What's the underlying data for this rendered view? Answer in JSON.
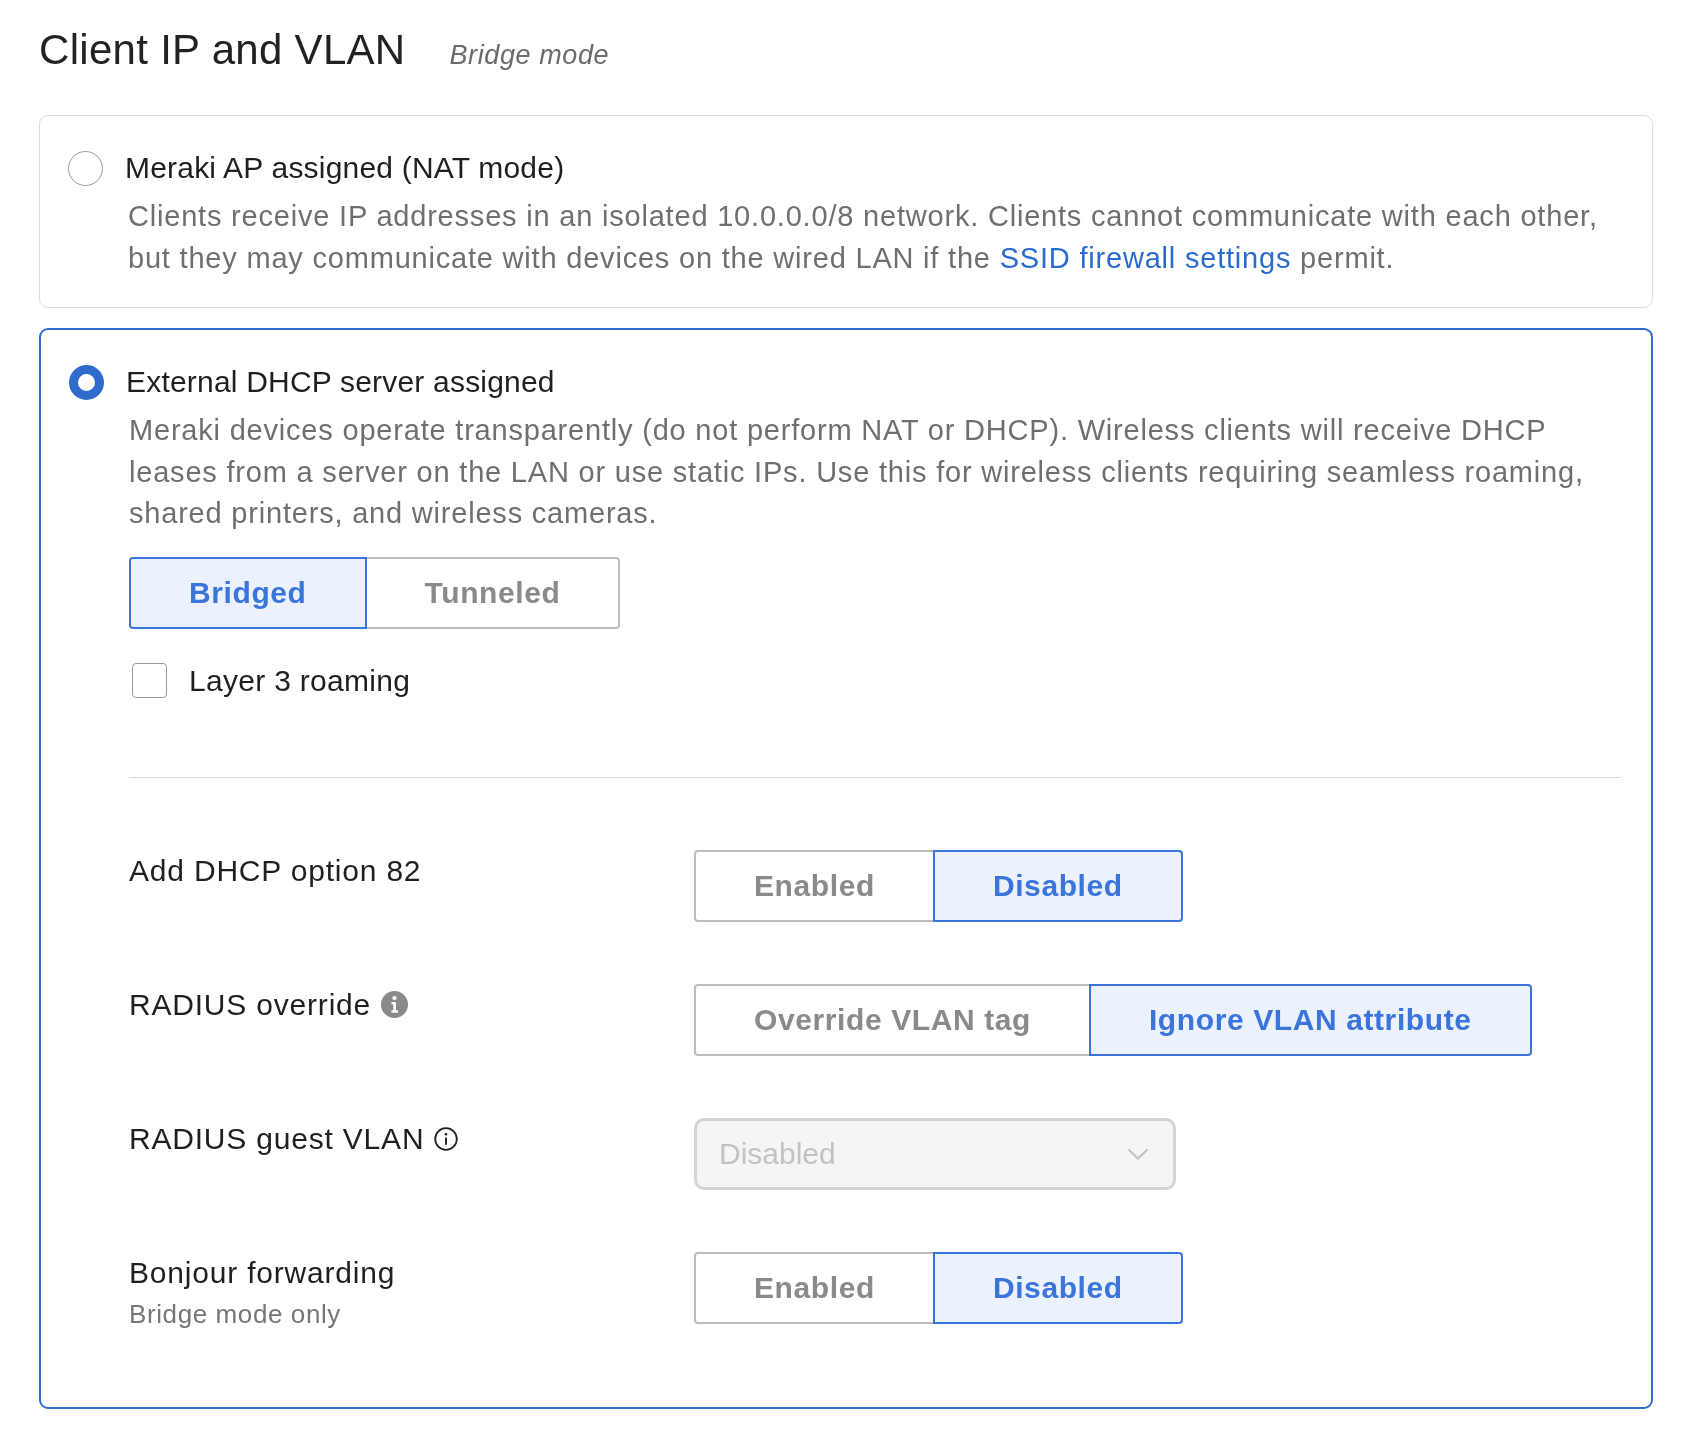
{
  "header": {
    "title": "Client IP and VLAN",
    "subtitle": "Bridge mode"
  },
  "options": [
    {
      "label": "Meraki AP assigned (NAT mode)",
      "selected": false,
      "description": {
        "text": "Clients receive IP addresses in an isolated 10.0.0.0/8 network. Clients cannot communicate with each other, but they may communicate with devices on the wired LAN if the ",
        "link": "SSID firewall settings",
        "text_after": " permit."
      }
    },
    {
      "label": "External DHCP server assigned",
      "selected": true,
      "description": {
        "text": "Meraki devices operate transparently (do not perform NAT or DHCP). Wireless clients will receive DHCP leases from a server on the LAN or use static IPs. Use this for wireless clients requiring seamless roaming, shared printers, and wireless cameras."
      },
      "modes": [
        {
          "label": "Bridged",
          "selected": true
        },
        {
          "label": "Tunneled",
          "selected": false
        }
      ],
      "layer3_roaming": {
        "label": "Layer 3 roaming",
        "checked": false
      },
      "settings": [
        {
          "kind": "segmented",
          "label": "Add DHCP option 82",
          "choices": [
            {
              "label": "Enabled",
              "selected": false
            },
            {
              "label": "Disabled",
              "selected": true
            }
          ]
        },
        {
          "kind": "segmented",
          "label": "RADIUS override",
          "info": {
            "kind": "filled"
          },
          "choices": [
            {
              "label": "Override VLAN tag",
              "selected": false
            },
            {
              "label": "Ignore VLAN attribute",
              "selected": true
            }
          ]
        },
        {
          "kind": "select",
          "label": "RADIUS guest VLAN",
          "info": {
            "kind": "outline"
          },
          "value": "Disabled",
          "disabled": true
        },
        {
          "kind": "segmented",
          "label": "Bonjour forwarding",
          "note": "Bridge mode only",
          "choices": [
            {
              "label": "Enabled",
              "selected": false
            },
            {
              "label": "Disabled",
              "selected": true
            }
          ]
        }
      ]
    }
  ]
}
